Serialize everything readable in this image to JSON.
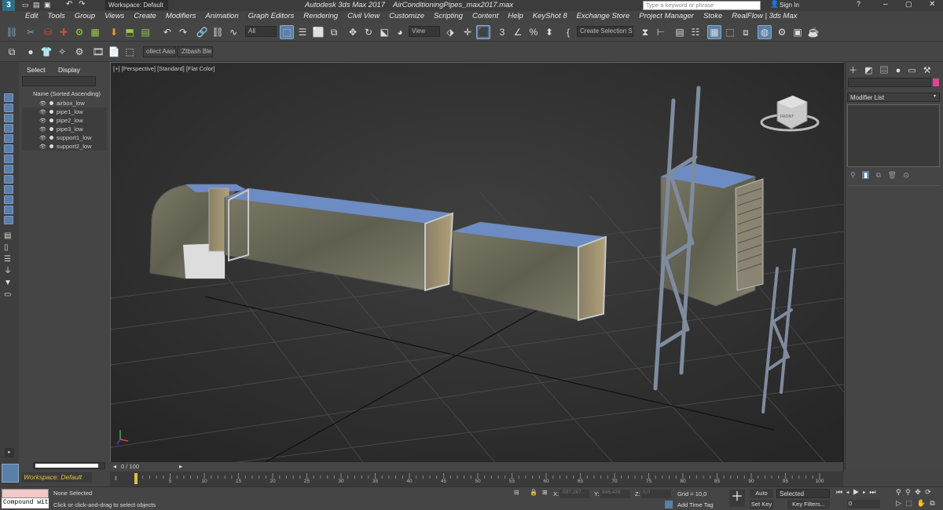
{
  "titlebar": {
    "app_title": "Autodesk 3ds Max 2017",
    "file_name": "AirConditioningPipes_max2017.max",
    "workspace_label": "Workspace: Default",
    "search_placeholder": "Type a keyword or phrase",
    "sign_in": "Sign In",
    "logo_text": "3"
  },
  "menu": {
    "items": [
      "Edit",
      "Tools",
      "Group",
      "Views",
      "Create",
      "Modifiers",
      "Animation",
      "Graph Editors",
      "Rendering",
      "Civil View",
      "Customize",
      "Scripting",
      "Content",
      "Help",
      "KeyShot 8",
      "Exchange Store",
      "Project Manager",
      "Stoke",
      "RealFlow | 3ds Max"
    ]
  },
  "toolbar": {
    "selection_filter": "All",
    "ref_coord": "View",
    "named_selection_placeholder": "Create Selection Se",
    "collect_asset": "ollect Aasset",
    "ztbash": ":Ztbash Blende"
  },
  "scene_explorer": {
    "tab_select": "Select",
    "tab_display": "Display",
    "column_header": "Name (Sorted Ascending)",
    "objects": [
      "airbox_low",
      "pipe1_low",
      "pipe2_low",
      "pipe3_low",
      "support1_low",
      "support2_low"
    ],
    "workspace_footer": "Workspace: Default"
  },
  "viewport": {
    "label_plus": "[+]",
    "label_view": "[Perspective]",
    "label_shading": "[Standard]",
    "label_style": "[Flat Color]",
    "viewcube_label": "FRONT"
  },
  "command_panel": {
    "modifier_list": "Modifier List"
  },
  "timeline": {
    "frame_counter": "0 / 100",
    "ticks": [
      "0",
      "5",
      "10",
      "15",
      "20",
      "25",
      "30",
      "35",
      "40",
      "45",
      "50",
      "55",
      "60",
      "65",
      "70",
      "75",
      "80",
      "85",
      "90",
      "95",
      "100"
    ]
  },
  "status": {
    "listener_text": "Compound wit",
    "selection_status": "None Selected",
    "prompt": "Click or click-and-drag to select objects",
    "x_label": "X:",
    "x_value": "-587,287",
    "y_label": "Y:",
    "y_value": "646,426",
    "z_label": "Z:",
    "z_value": "0,0",
    "grid": "Grid = 10,0",
    "add_time_tag": "Add Time Tag",
    "auto_key": "Auto Key",
    "selected": "Selected",
    "set_key": "Set Key",
    "key_filters": "Key Filters...",
    "frame_input": "0"
  },
  "colors": {
    "accent_blue": "#5a7fa8",
    "workspace_yellow": "#e0c040",
    "duct_top_blue": "#6d8cc4",
    "duct_side": "#7a7766"
  }
}
